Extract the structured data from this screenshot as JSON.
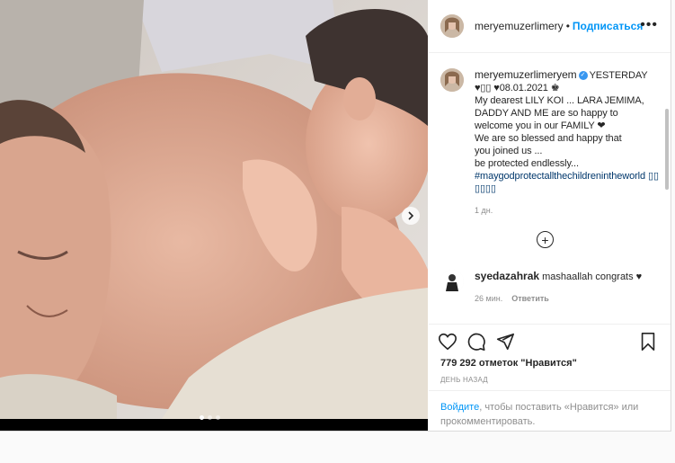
{
  "post": {
    "username": "meryemuzerlimery",
    "separator": "•",
    "follow_label": "Подписаться",
    "more_icon": "more-horizontal-icon"
  },
  "caption": {
    "username": "meryemuzerlimeryem",
    "text_line1": "YESTERDAY",
    "text_body": "♥▯▯ ♥08.01.2021 ♚\nMy dearest LILY KOI ... LARA JEMIMA,\nDADDY AND ME are so happy to\nwelcome you in our FAMILY ❤\nWe are so blessed and happy that\nyou joined us ...\nbe protected endlessly...",
    "hashtag": "#maygodprotectallthechildrenintheworld ▯▯▯▯▯▯",
    "time": "1 дн."
  },
  "comment": {
    "username": "syedazahrak",
    "text": "mashaallah congrats ♥",
    "time": "26 мин.",
    "reply_label": "Ответить"
  },
  "actions": {
    "likes": "779 292 отметок \"Нравится\"",
    "date": "ДЕНЬ НАЗАД"
  },
  "login_prompt": {
    "link": "Войдите",
    "text": ", чтобы поставить «Нравится» или прокомментировать."
  },
  "colors": {
    "link": "#0095f6",
    "hashtag": "#00376b",
    "muted": "#8e8e8e"
  }
}
